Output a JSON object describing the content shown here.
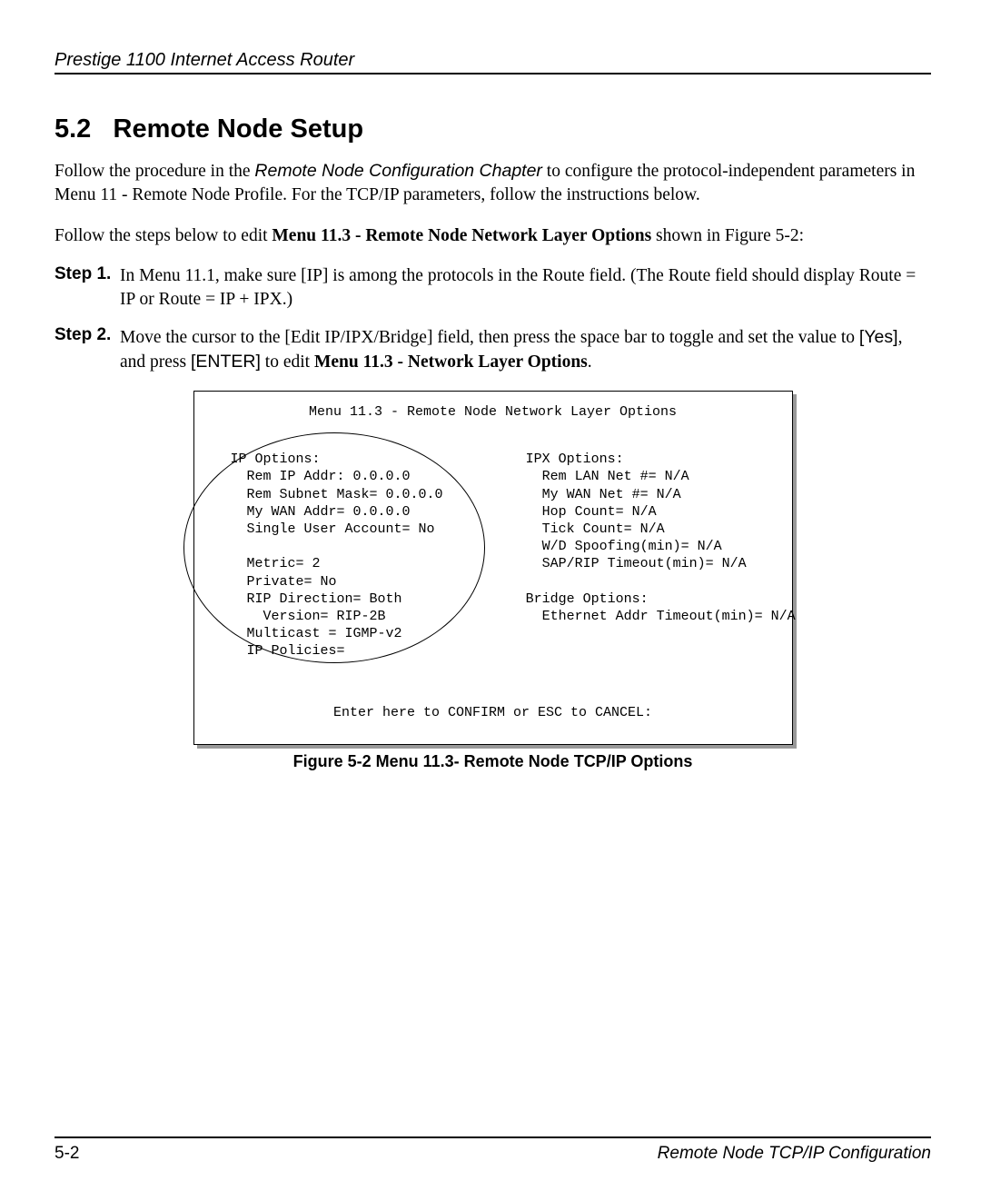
{
  "header": {
    "title": "Prestige 1100 Internet Access Router"
  },
  "section": {
    "number": "5.2",
    "title": "Remote Node Setup"
  },
  "intro": {
    "pre": "Follow the procedure in the ",
    "link": "Remote Node Configuration Chapter",
    "post": " to configure the protocol-independent parameters in Menu 11 - Remote Node Profile.  For the TCP/IP parameters, follow the instructions below."
  },
  "follow": {
    "pre": "Follow the steps below to edit ",
    "bold": "Menu 11.3 - Remote Node Network Layer Options",
    "post": " shown in Figure 5-2:"
  },
  "steps": [
    {
      "label": "Step 1.",
      "text": "In Menu 11.1, make sure [IP] is among the protocols in the Route field. (The Route field should display Route = IP or Route = IP + IPX.)"
    },
    {
      "label": "Step 2.",
      "pre": "Move the cursor to the [Edit IP/IPX/Bridge] field, then press the space bar to toggle and set the value to ",
      "yes": "[Yes]",
      "mid": ", and press ",
      "enter": "[ENTER]",
      "aft": " to edit ",
      "bold": "Menu 11.3 - Network Layer Options",
      "end": "."
    }
  ],
  "chart_data": {
    "type": "table",
    "title": "Menu 11.3 - Remote Node Network Layer Options",
    "left_header": "IP Options:",
    "left": [
      "Rem IP Addr: 0.0.0.0",
      "Rem Subnet Mask= 0.0.0.0",
      "My WAN Addr= 0.0.0.0",
      "Single User Account= No",
      "",
      "Metric= 2",
      "Private= No",
      "RIP Direction= Both",
      "  Version= RIP-2B",
      "Multicast = IGMP-v2",
      "IP Policies="
    ],
    "right_header": "IPX Options:",
    "right": [
      "Rem LAN Net #= N/A",
      "My WAN Net #= N/A",
      "Hop Count= N/A",
      "Tick Count= N/A",
      "W/D Spoofing(min)= N/A",
      "SAP/RIP Timeout(min)= N/A"
    ],
    "bridge_header": "Bridge Options:",
    "bridge": [
      "Ethernet Addr Timeout(min)= N/A"
    ],
    "footer": "Enter here to CONFIRM or ESC to CANCEL:",
    "highlight": "IP Options block is circled"
  },
  "figure_caption": "Figure 5-2 Menu 11.3- Remote Node TCP/IP Options",
  "footer": {
    "page": "5-2",
    "chapter": "Remote Node TCP/IP Configuration"
  }
}
